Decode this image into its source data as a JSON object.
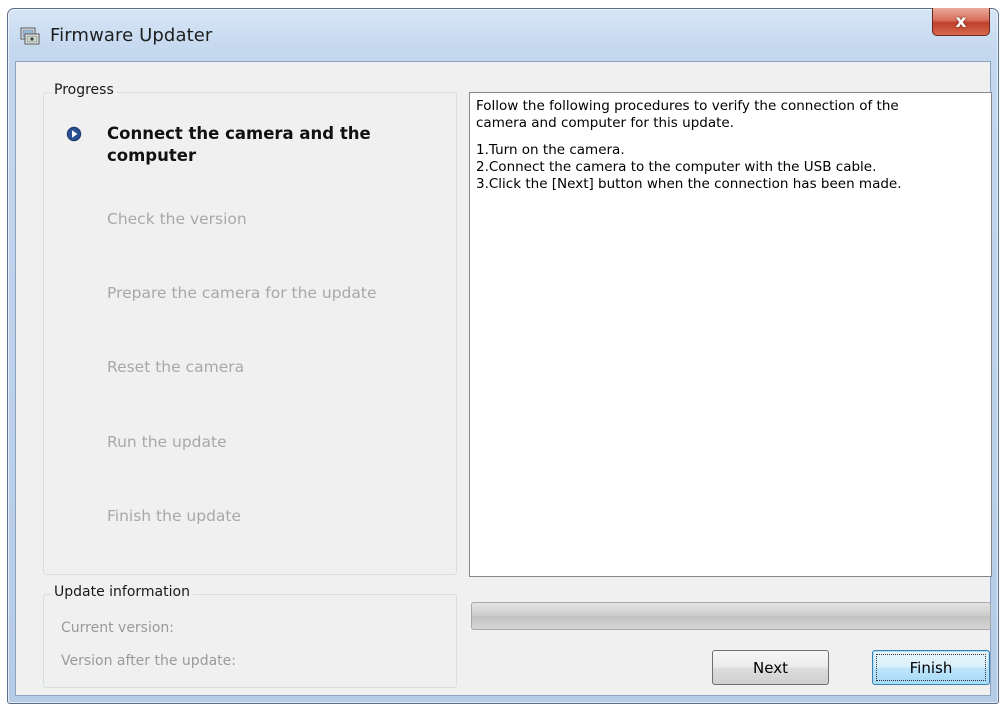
{
  "window": {
    "title": "Firmware Updater",
    "close_label": "x",
    "icon": "firmware-updater-app-icon"
  },
  "progress": {
    "legend": "Progress",
    "steps": [
      {
        "label": "Connect the camera and the computer",
        "state": "active"
      },
      {
        "label": "Check the version",
        "state": "pending"
      },
      {
        "label": "Prepare the camera for the update",
        "state": "pending"
      },
      {
        "label": "Reset the camera",
        "state": "pending"
      },
      {
        "label": "Run the update",
        "state": "pending"
      },
      {
        "label": "Finish the update",
        "state": "pending"
      }
    ]
  },
  "instructions": {
    "intro_line1": "Follow the following procedures to verify the connection of the",
    "intro_line2": "camera and computer for this update.",
    "step1": "1.Turn on the camera.",
    "step2": "2.Connect the camera to the computer with the USB cable.",
    "step3": "3.Click the [Next] button when the connection has been made."
  },
  "update_info": {
    "legend": "Update information",
    "current_version_label": "Current version:",
    "current_version_value": "",
    "after_version_label": "Version after the update:",
    "after_version_value": ""
  },
  "progress_bar": {
    "percent": 0
  },
  "buttons": {
    "next": "Next",
    "finish": "Finish"
  },
  "colors": {
    "active_step_marker": "#1f3b73",
    "inactive_text": "#a8a8a8",
    "close_button": "#c7432c"
  }
}
